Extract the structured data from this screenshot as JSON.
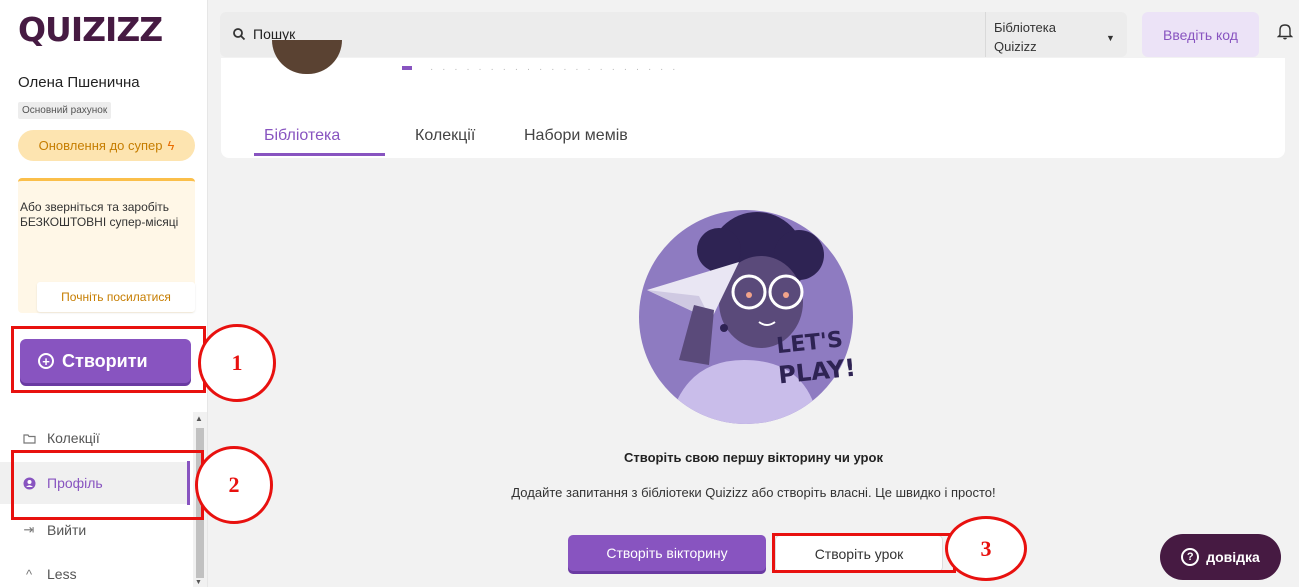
{
  "sidebar": {
    "logo": "QUIZIZZ",
    "user_name": "Олена Пшенична",
    "account_type": "Основний рахунок",
    "upgrade_label": "Оновлення до супер",
    "promo_text": "Або зверніться та заробіть БЕЗКОШТОВНІ супер-місяці",
    "promo_link": "Почніть посилатися",
    "create_label": "Створити",
    "nav": [
      {
        "label": "Колекції",
        "icon": "folder-icon"
      },
      {
        "label": "Профіль",
        "icon": "user-icon",
        "active": true
      },
      {
        "label": "Вийти",
        "icon": "logout-icon"
      },
      {
        "label": "Less",
        "icon": "chevron-up-icon"
      }
    ]
  },
  "topbar": {
    "search_placeholder": "Пошук",
    "library_line1": "Бібліотека",
    "library_line2": "Quizizz",
    "enter_code": "Введіть код"
  },
  "profile": {
    "tabs": [
      "Бібліотека",
      "Колекції",
      "Набори мемів"
    ],
    "active_tab": "Бібліотека"
  },
  "empty_state": {
    "title": "Створіть свою першу вікторину чи урок",
    "description": "Додайте запитання з бібліотеки Quizizz або створіть власні. Це швидко і просто!",
    "create_quiz": "Створіть вікторину",
    "create_lesson": "Створіть урок",
    "illustration_text": "LET'S PLAY!"
  },
  "help_label": "довідка",
  "annotations": [
    "1",
    "2",
    "3"
  ],
  "colors": {
    "brand_purple": "#8854c0",
    "brand_dark": "#461a42",
    "annotation_red": "#e8110f",
    "upgrade_bg": "#fde4b0"
  }
}
